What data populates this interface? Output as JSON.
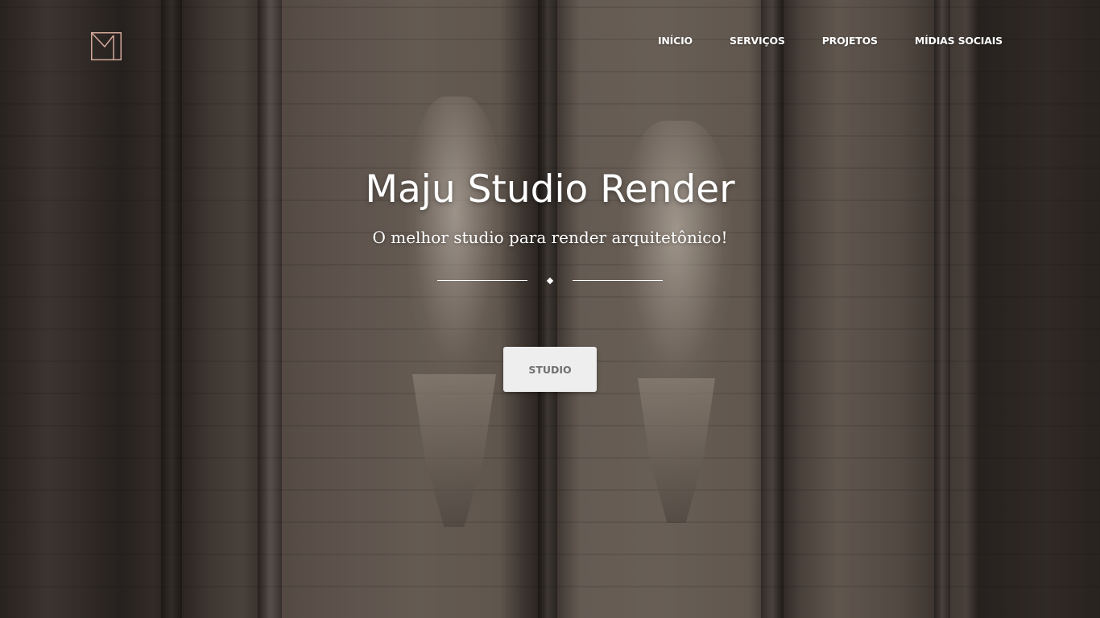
{
  "brand": {
    "logo_icon": "envelope-m-icon",
    "logo_color": "#d4a89a"
  },
  "nav": {
    "items": [
      {
        "label": "INÍCIO"
      },
      {
        "label": "SERVIÇOS"
      },
      {
        "label": "PROJETOS"
      },
      {
        "label": "MÍDIAS SOCIAIS"
      }
    ]
  },
  "hero": {
    "title": "Maju Studio Render",
    "subtitle": "O melhor studio para render arquitetônico!",
    "cta_label": "STUDIO",
    "divider_icon": "diamond-icon"
  }
}
